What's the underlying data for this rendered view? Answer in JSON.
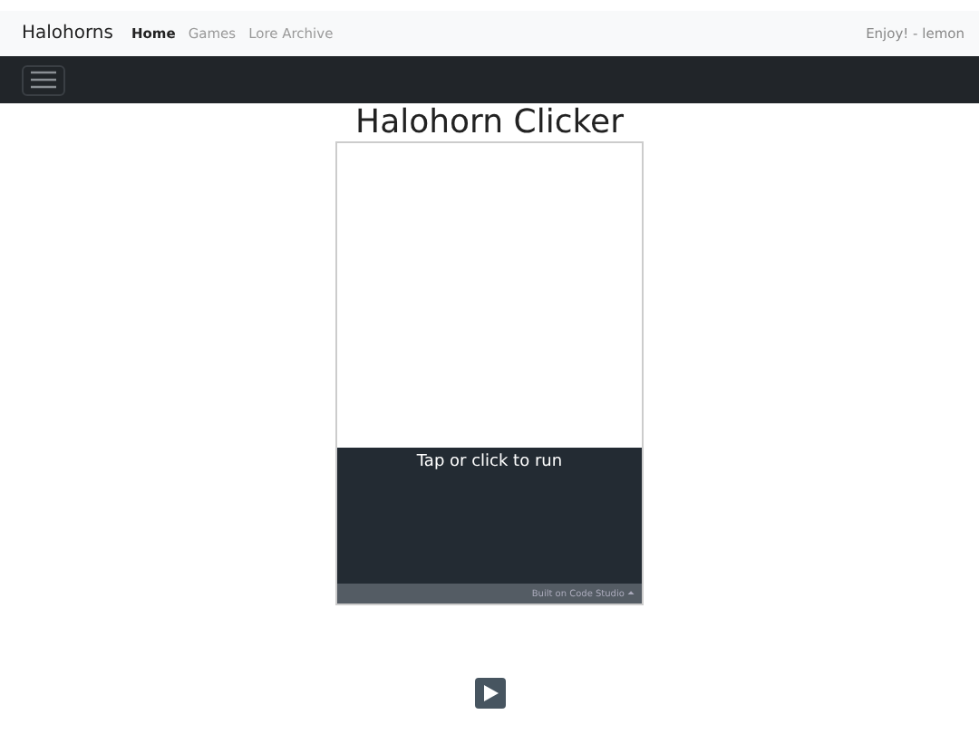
{
  "navbar": {
    "brand": "Halohorns",
    "links": [
      {
        "label": "Home",
        "selected": true
      },
      {
        "label": "Games",
        "selected": false
      },
      {
        "label": "Lore Archive",
        "selected": false
      }
    ],
    "greeting": "Enjoy! - lemon"
  },
  "title": "Halohorn Clicker",
  "app": {
    "prompt": "Tap or click to run",
    "footer": "Built on Code Studio",
    "footer_caret": "⏶"
  }
}
